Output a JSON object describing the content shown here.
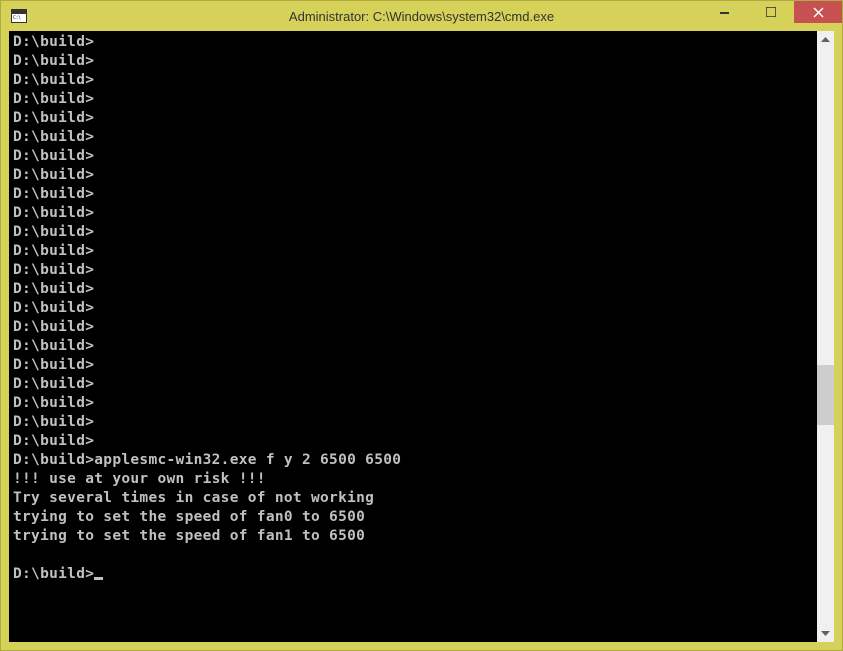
{
  "window": {
    "title": "Administrator: C:\\Windows\\system32\\cmd.exe"
  },
  "terminal": {
    "prompt": "D:\\build>",
    "empty_prompt_count": 22,
    "command": "applesmc-win32.exe f y 2 6500 6500",
    "output": [
      "!!! use at your own risk !!!",
      "Try several times in case of not working",
      "trying to set the speed of fan0 to 6500",
      "trying to set the speed of fan1 to 6500"
    ],
    "blank_line": ""
  }
}
